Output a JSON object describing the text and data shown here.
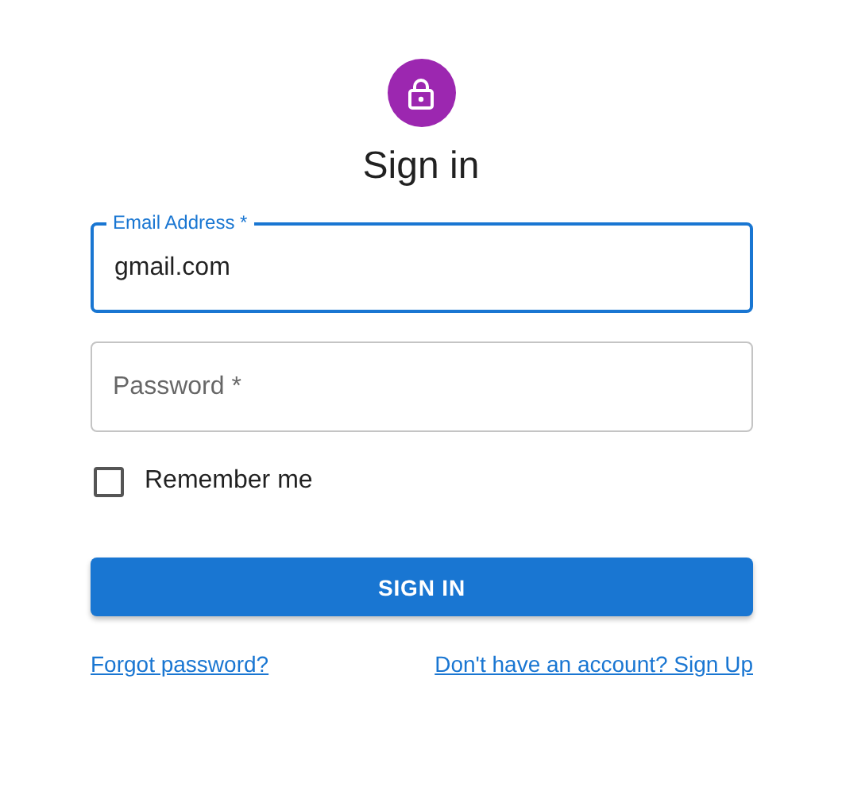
{
  "title": "Sign in",
  "fields": [
    {
      "label": "Email Address *",
      "value": "gmail.com",
      "focused": true
    },
    {
      "placeholder": "Password *",
      "focused": false
    }
  ],
  "remember": {
    "label": "Remember me",
    "checked": false
  },
  "submit": "SIGN IN",
  "links": [
    "Forgot password?",
    "Don't have an account? Sign Up"
  ]
}
